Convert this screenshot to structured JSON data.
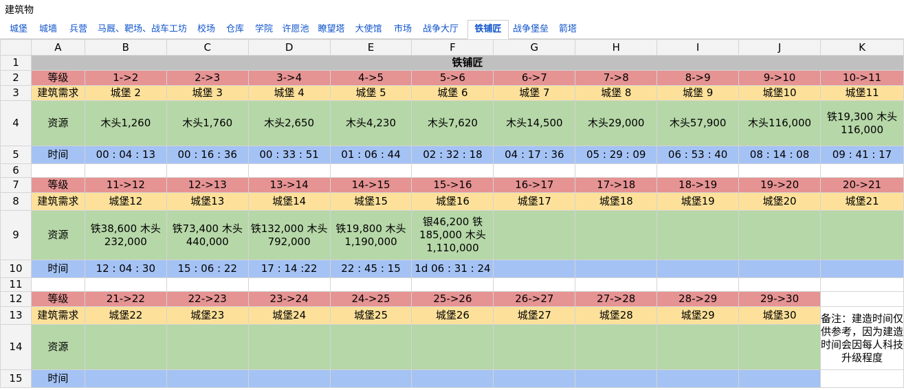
{
  "window_title": "建筑物",
  "tabs": [
    "城堡",
    "城墙",
    "兵营",
    "马厩、靶场、战车工坊",
    "校场",
    "仓库",
    "学院",
    "许愿池",
    "瞭望塔",
    "大使馆",
    "市场",
    "战争大厅",
    "铁铺匠",
    "战争堡垒",
    "箭塔"
  ],
  "active_tab": "铁铺匠",
  "columns": [
    "A",
    "B",
    "C",
    "D",
    "E",
    "F",
    "G",
    "H",
    "I",
    "J",
    "K"
  ],
  "rows": [
    "1",
    "2",
    "3",
    "4",
    "5",
    "6",
    "7",
    "8",
    "9",
    "10",
    "11",
    "12",
    "13",
    "14",
    "15"
  ],
  "sheet_title": "铁铺匠",
  "labels": {
    "level": "等级",
    "requirement": "建筑需求",
    "resource": "资源",
    "time": "时间"
  },
  "block1": {
    "levels": [
      "1->2",
      "2->3",
      "3->4",
      "4->5",
      "5->6",
      "6->7",
      "7->8",
      "8->9",
      "9->10",
      "10->11"
    ],
    "requirements": [
      "城堡 2",
      "城堡 3",
      "城堡 4",
      "城堡 5",
      "城堡 6",
      "城堡 7",
      "城堡 8",
      "城堡 9",
      "城堡10",
      "城堡11"
    ],
    "resources": [
      "木头1,260",
      "木头1,760",
      "木头2,650",
      "木头4,230",
      "木头7,620",
      "木头14,500",
      "木头29,000",
      "木头57,900",
      "木头116,000",
      "铁19,300 木头116,000"
    ],
    "times": [
      "00 : 04 : 13",
      "00 : 16 : 36",
      "00 : 33 : 51",
      "01 : 06 : 44",
      "02 : 32 : 18",
      "04 : 17 : 36",
      "05 : 29 : 09",
      "06 : 53 : 40",
      "08 : 14 : 08",
      "09 : 41 : 17"
    ]
  },
  "block2": {
    "levels": [
      "11->12",
      "12->13",
      "13->14",
      "14->15",
      "15->16",
      "16->17",
      "17->18",
      "18->19",
      "19->20",
      "20->21"
    ],
    "requirements": [
      "城堡12",
      "城堡13",
      "城堡14",
      "城堡15",
      "城堡16",
      "城堡17",
      "城堡18",
      "城堡19",
      "城堡20",
      "城堡21"
    ],
    "resources": [
      "铁38,600 木头232,000",
      "铁73,400 木头 440,000",
      "铁132,000 木头 792,000",
      "铁19,800 木头 1,190,000",
      "银46,200 铁 185,000 木头 1,110,000",
      "",
      "",
      "",
      "",
      ""
    ],
    "times": [
      "12 : 04 : 30",
      "15 : 06 : 22",
      "17 : 14 :22",
      "22 : 45 : 15",
      "1d 06 : 31 : 24",
      "",
      "",
      "",
      "",
      ""
    ]
  },
  "block3": {
    "levels": [
      "21->22",
      "22->23",
      "23->24",
      "24->25",
      "25->26",
      "26->27",
      "27->28",
      "28->29",
      "29->30"
    ],
    "requirements": [
      "城堡22",
      "城堡23",
      "城堡24",
      "城堡25",
      "城堡26",
      "城堡27",
      "城堡28",
      "城堡29",
      "城堡30"
    ],
    "note": "备注：建造时间仅供参考，因为建造时间会因每人科技升级程度"
  }
}
